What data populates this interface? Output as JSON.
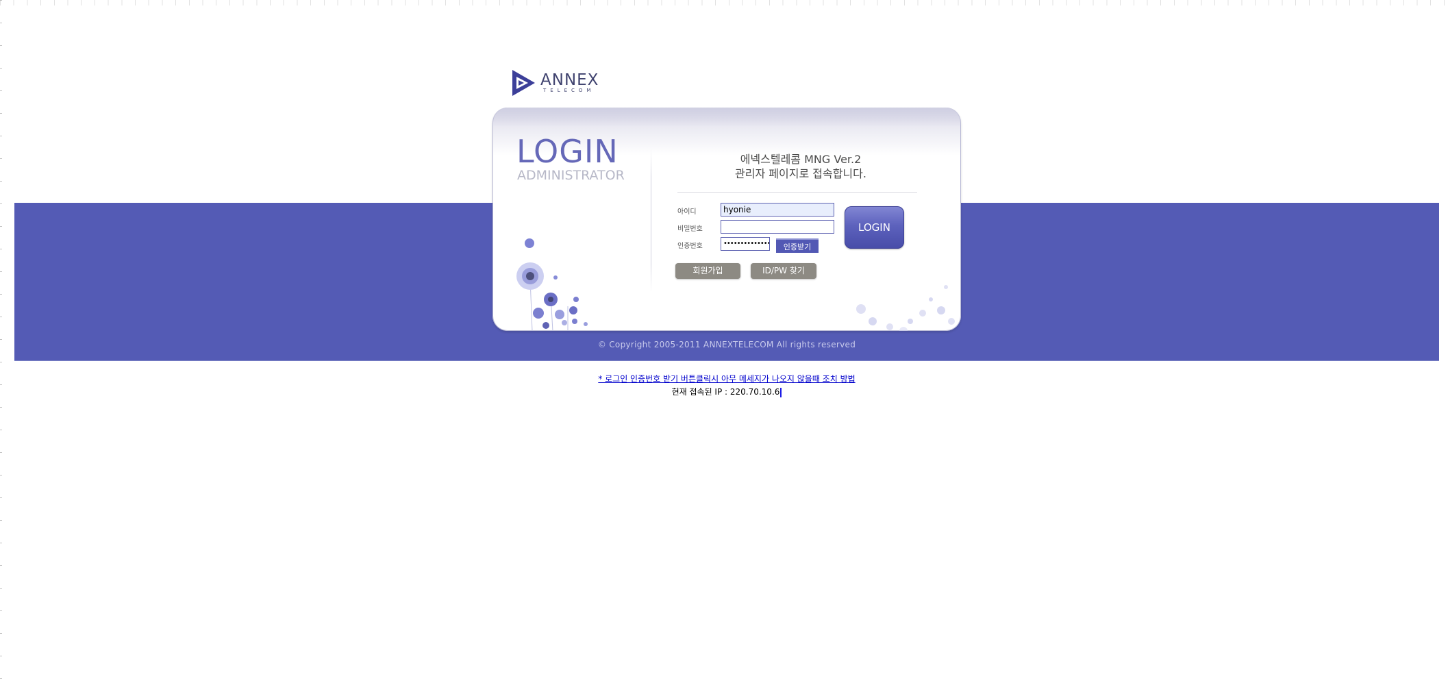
{
  "brand": {
    "name": "ANNEX",
    "sub": "TELECOM"
  },
  "login_box": {
    "title": "LOGIN",
    "subtitle": "ADMINISTRATOR",
    "heading_line1": "에넥스텔레콤 MNG Ver.2",
    "heading_line2": "관리자 페이지로 접속합니다.",
    "fields": {
      "id_label": "아이디",
      "id_value": "hyonie",
      "password_label": "비밀번호",
      "password_value": "",
      "auth_label": "인증번호",
      "auth_value": "••••••••••••••"
    },
    "auth_button": "인증받기",
    "login_button": "LOGIN",
    "signup_button": "회원가입",
    "find_button": "ID/PW 찾기"
  },
  "copyright": "© Copyright 2005-2011 ANNEXTELECOM All rights reserved",
  "help_link": "* 로그인 인증번호 받기 버튼클릭시 아무 메세지가 나오지 않을때 조치 방법",
  "ip_line": "현재 접속된 IP : 220.70.10.6",
  "colors": {
    "band": "#545bb5",
    "accent": "#5258b4",
    "login_title": "#6568b8",
    "gray_button": "#8d8a83",
    "link": "#0000cc"
  },
  "icons": [
    "annex-logo-icon"
  ]
}
